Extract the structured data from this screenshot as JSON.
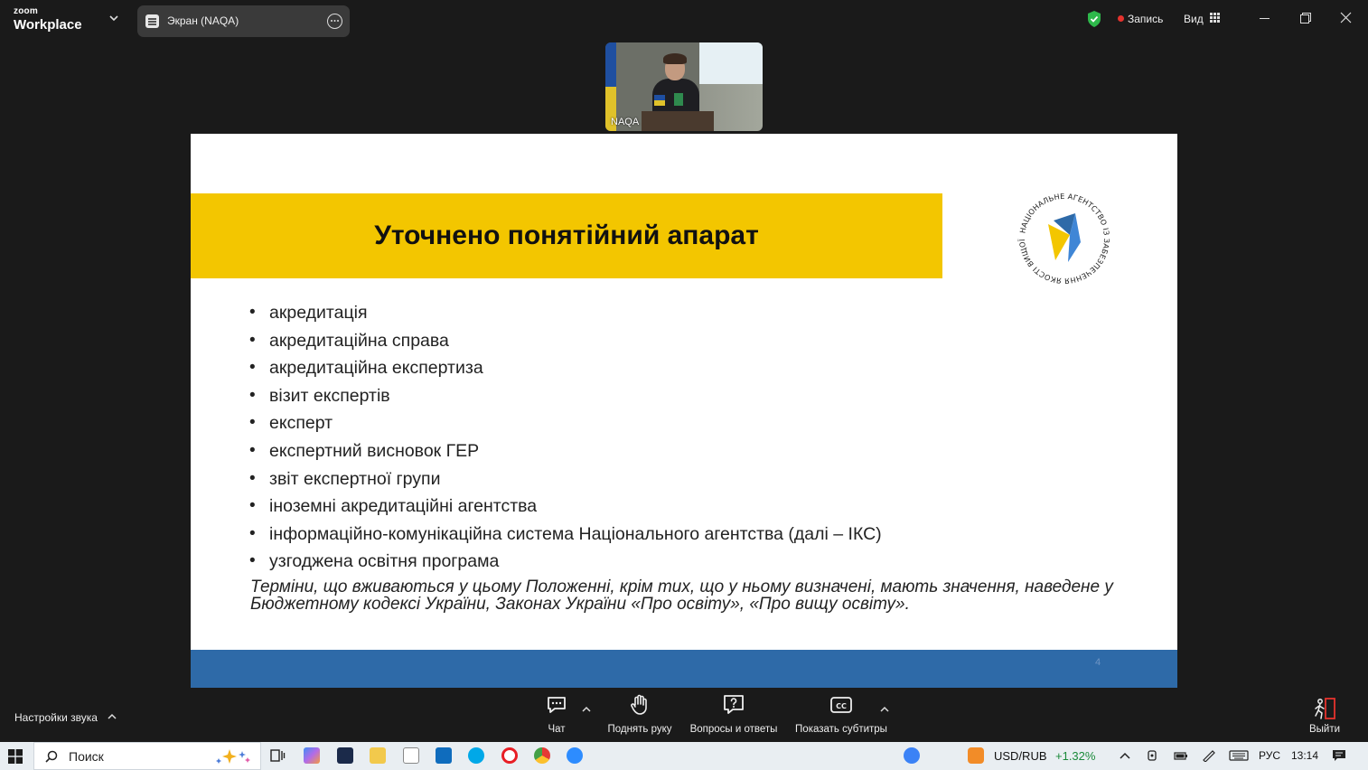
{
  "window": {
    "brand_small": "zoom",
    "brand_big": "Workplace",
    "share_tab_label": "Экран (NAQA)",
    "record_label": "Запись",
    "view_label": "Вид"
  },
  "video": {
    "participant_name": "NAQA"
  },
  "slide": {
    "title": "Уточнено понятійний апарат",
    "bullets": [
      "акредитація",
      "акредитаційна справа",
      "акредитаційна експертиза",
      "візит експертів",
      "експерт",
      "експертний висновок ГЕР",
      "звіт експертної групи",
      "іноземні акредитаційні агентства",
      "інформаційно-комунікаційна система Національного агентства (далі – ІКС)",
      "узгоджена освітня програма"
    ],
    "note": "Терміни, що вживаються у цьому Положенні, крім тих, що у ньому визначені, мають значення, наведене у Бюджетному кодексі України, Законах України «Про освіту», «Про вищу освіту».",
    "page_number": "4",
    "logo_text": "НАЦІОНАЛЬНЕ АГЕНТСТВО ІЗ ЗАБЕЗПЕЧЕННЯ ЯКОСТІ ВИЩОЇ ОСВІТИ",
    "colors": {
      "title_band": "#f3c600",
      "footer_band": "#2e6aa8"
    }
  },
  "toolbar": {
    "audio_settings": "Настройки звука",
    "chat": "Чат",
    "raise_hand": "Поднять руку",
    "qa": "Вопросы и ответы",
    "captions": "Показать субтитры",
    "leave": "Выйти"
  },
  "taskbar": {
    "search_placeholder": "Поиск",
    "ticker": "USD/RUB",
    "ticker_change": "+1.32%",
    "language": "РУС",
    "time": "13:14"
  }
}
